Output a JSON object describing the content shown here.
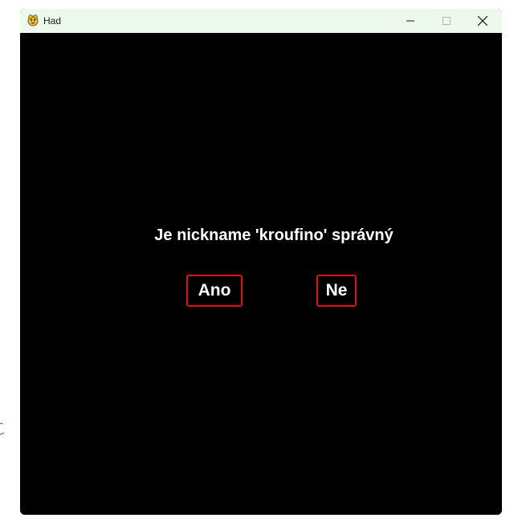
{
  "window": {
    "title": "Had",
    "controls": {
      "minimize_icon": "minimize-icon",
      "maximize_icon": "maximize-icon",
      "close_icon": "close-icon"
    }
  },
  "dialog": {
    "question": "Je nickname 'kroufino' správný",
    "yes_label": "Ano",
    "no_label": "Ne"
  },
  "colors": {
    "titlebar_bg": "#ecf9ec",
    "content_bg": "#000000",
    "text": "#ffffff",
    "button_border": "#e01010"
  }
}
